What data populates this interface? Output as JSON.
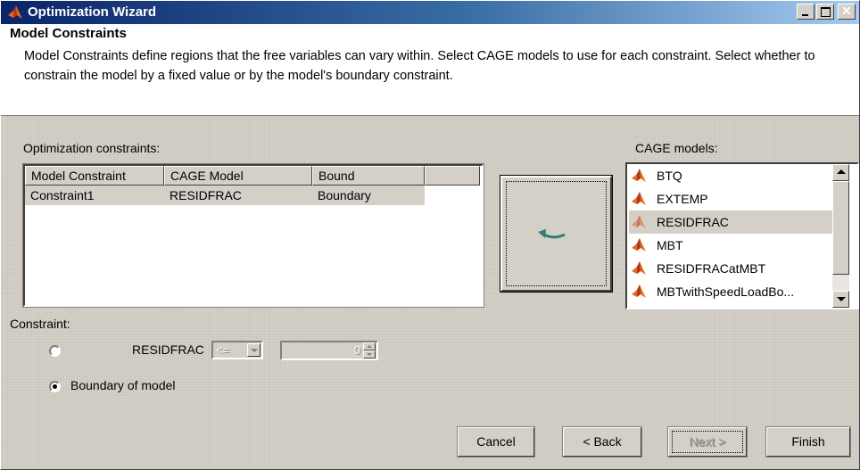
{
  "window": {
    "title": "Optimization Wizard"
  },
  "header": {
    "title": "Model Constraints",
    "description": "Model Constraints define regions that the free variables can vary within. Select CAGE models to use for each constraint. Select whether to constrain the model by a fixed value or by the model's boundary constraint."
  },
  "constraints": {
    "label": "Optimization constraints:",
    "columns": [
      "Model Constraint",
      "CAGE Model",
      "Bound"
    ],
    "rows": [
      [
        "Constraint1",
        "RESIDFRAC",
        "Boundary"
      ]
    ]
  },
  "models": {
    "label": "CAGE models:",
    "items": [
      "BTQ",
      "EXTEMP",
      "RESIDFRAC",
      "MBT",
      "RESIDFRACatMBT",
      "MBTwithSpeedLoadBo..."
    ],
    "selected": "RESIDFRAC"
  },
  "constraint": {
    "label": "Constraint:",
    "model_name": "RESIDFRAC",
    "operator": "<=",
    "value": "0",
    "boundary_label": "Boundary of model",
    "selected_option": "boundary"
  },
  "buttons": {
    "cancel": "Cancel",
    "back": "< Back",
    "next": "Next >",
    "finish": "Finish"
  },
  "colors": {
    "title_start": "#0a246a",
    "title_end": "#a6caf0",
    "arrow": "#2e7d7b",
    "face": "#d4d0c8"
  },
  "icons": [
    "matlab-logo-icon",
    "minimize-icon",
    "maximize-icon",
    "close-icon",
    "add-arrow-icon",
    "scroll-up-icon",
    "scroll-down-icon"
  ]
}
